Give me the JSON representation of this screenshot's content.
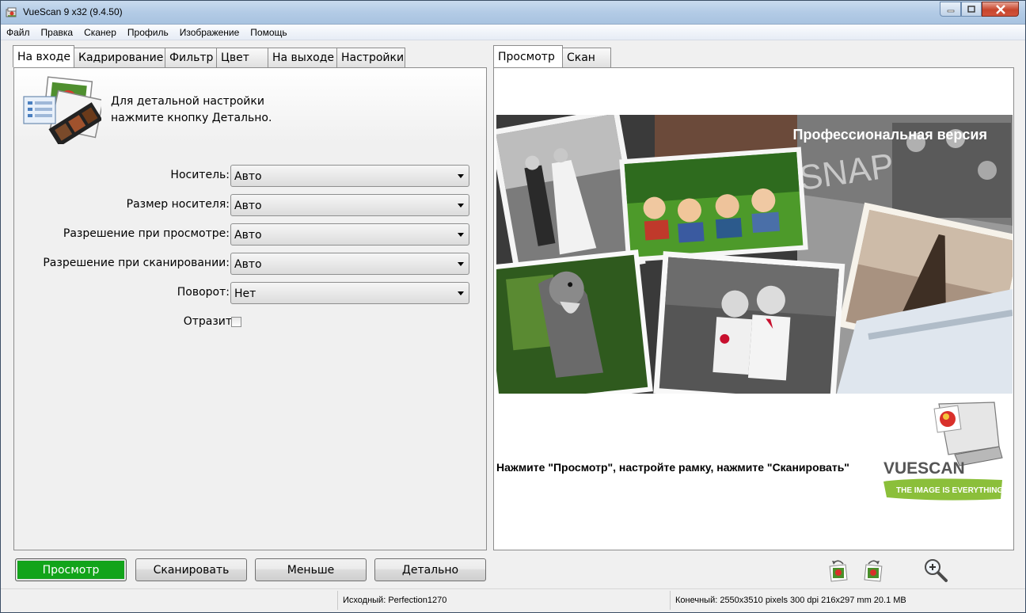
{
  "window": {
    "title": "VueScan 9 x32 (9.4.50)"
  },
  "menu": [
    "Файл",
    "Правка",
    "Сканер",
    "Профиль",
    "Изображение",
    "Помощь"
  ],
  "left_tabs": [
    "На входе",
    "Кадрирование",
    "Фильтр",
    "Цвет",
    "На выходе",
    "Настройки"
  ],
  "left_active_tab": "На входе",
  "hint": {
    "line1": "Для детальной настройки",
    "line2": "нажмите кнопку Детально."
  },
  "fields": [
    {
      "label": "Носитель:",
      "value": "Авто"
    },
    {
      "label": "Размер носителя:",
      "value": "Авто"
    },
    {
      "label": "Разрешение при просмотре:",
      "value": "Авто"
    },
    {
      "label": "Разрешение при сканировании:",
      "value": "Авто"
    },
    {
      "label": "Поворот:",
      "value": "Нет"
    }
  ],
  "mirror": {
    "label": "Отразить:",
    "checked": false
  },
  "right_tabs": [
    "Просмотр",
    "Скан"
  ],
  "right_active_tab": "Просмотр",
  "banner": {
    "title": "Профессиональная версия",
    "snap_text": "SNAP"
  },
  "instruction": "Нажмите \"Просмотр\", настройте рамку, нажмите \"Сканировать\"",
  "logo": {
    "name": "VUESCAN",
    "tagline": "THE IMAGE IS EVERYTHING"
  },
  "buttons": {
    "preview": "Просмотр",
    "scan": "Сканировать",
    "less": "Меньше",
    "more": "Детально"
  },
  "toolbar_icons": [
    "rotate-left-icon",
    "rotate-right-icon",
    "zoom-in-icon"
  ],
  "status": {
    "source": "Исходный: Perfection1270",
    "output": "Конечный: 2550x3510 pixels 300 dpi 216x297 mm 20.1 MB"
  },
  "colors": {
    "preview_button": "#14a01e",
    "window_title_bar": "#b3cbe6",
    "close_button": "#c7452d",
    "logo_green": "#8bbf3a"
  }
}
